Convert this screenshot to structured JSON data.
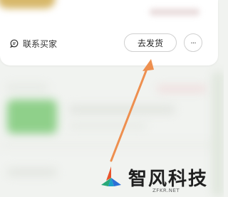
{
  "order_card": {
    "contact_label": "联系买家",
    "ship_button_label": "去发货",
    "more_button_label": "···"
  },
  "icons": {
    "contact": "chat-bubble-icon",
    "more": "more-dots-icon",
    "watermark_logo": "zfkr-logo-icon"
  },
  "annotation": {
    "arrow_color": "#ee8f4f"
  },
  "watermark": {
    "brand": "智风科技",
    "site": "ZFKR.NET"
  }
}
